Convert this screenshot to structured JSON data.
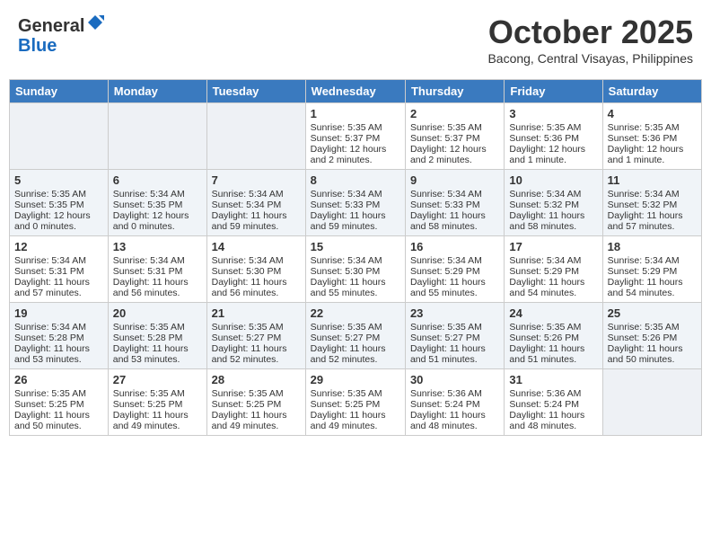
{
  "header": {
    "logo_line1": "General",
    "logo_line2": "Blue",
    "month": "October 2025",
    "location": "Bacong, Central Visayas, Philippines"
  },
  "weekdays": [
    "Sunday",
    "Monday",
    "Tuesday",
    "Wednesday",
    "Thursday",
    "Friday",
    "Saturday"
  ],
  "weeks": [
    [
      {
        "day": "",
        "empty": true
      },
      {
        "day": "",
        "empty": true
      },
      {
        "day": "",
        "empty": true
      },
      {
        "day": "1",
        "sunrise": "Sunrise: 5:35 AM",
        "sunset": "Sunset: 5:37 PM",
        "daylight": "Daylight: 12 hours and 2 minutes."
      },
      {
        "day": "2",
        "sunrise": "Sunrise: 5:35 AM",
        "sunset": "Sunset: 5:37 PM",
        "daylight": "Daylight: 12 hours and 2 minutes."
      },
      {
        "day": "3",
        "sunrise": "Sunrise: 5:35 AM",
        "sunset": "Sunset: 5:36 PM",
        "daylight": "Daylight: 12 hours and 1 minute."
      },
      {
        "day": "4",
        "sunrise": "Sunrise: 5:35 AM",
        "sunset": "Sunset: 5:36 PM",
        "daylight": "Daylight: 12 hours and 1 minute."
      }
    ],
    [
      {
        "day": "5",
        "sunrise": "Sunrise: 5:35 AM",
        "sunset": "Sunset: 5:35 PM",
        "daylight": "Daylight: 12 hours and 0 minutes."
      },
      {
        "day": "6",
        "sunrise": "Sunrise: 5:34 AM",
        "sunset": "Sunset: 5:35 PM",
        "daylight": "Daylight: 12 hours and 0 minutes."
      },
      {
        "day": "7",
        "sunrise": "Sunrise: 5:34 AM",
        "sunset": "Sunset: 5:34 PM",
        "daylight": "Daylight: 11 hours and 59 minutes."
      },
      {
        "day": "8",
        "sunrise": "Sunrise: 5:34 AM",
        "sunset": "Sunset: 5:33 PM",
        "daylight": "Daylight: 11 hours and 59 minutes."
      },
      {
        "day": "9",
        "sunrise": "Sunrise: 5:34 AM",
        "sunset": "Sunset: 5:33 PM",
        "daylight": "Daylight: 11 hours and 58 minutes."
      },
      {
        "day": "10",
        "sunrise": "Sunrise: 5:34 AM",
        "sunset": "Sunset: 5:32 PM",
        "daylight": "Daylight: 11 hours and 58 minutes."
      },
      {
        "day": "11",
        "sunrise": "Sunrise: 5:34 AM",
        "sunset": "Sunset: 5:32 PM",
        "daylight": "Daylight: 11 hours and 57 minutes."
      }
    ],
    [
      {
        "day": "12",
        "sunrise": "Sunrise: 5:34 AM",
        "sunset": "Sunset: 5:31 PM",
        "daylight": "Daylight: 11 hours and 57 minutes."
      },
      {
        "day": "13",
        "sunrise": "Sunrise: 5:34 AM",
        "sunset": "Sunset: 5:31 PM",
        "daylight": "Daylight: 11 hours and 56 minutes."
      },
      {
        "day": "14",
        "sunrise": "Sunrise: 5:34 AM",
        "sunset": "Sunset: 5:30 PM",
        "daylight": "Daylight: 11 hours and 56 minutes."
      },
      {
        "day": "15",
        "sunrise": "Sunrise: 5:34 AM",
        "sunset": "Sunset: 5:30 PM",
        "daylight": "Daylight: 11 hours and 55 minutes."
      },
      {
        "day": "16",
        "sunrise": "Sunrise: 5:34 AM",
        "sunset": "Sunset: 5:29 PM",
        "daylight": "Daylight: 11 hours and 55 minutes."
      },
      {
        "day": "17",
        "sunrise": "Sunrise: 5:34 AM",
        "sunset": "Sunset: 5:29 PM",
        "daylight": "Daylight: 11 hours and 54 minutes."
      },
      {
        "day": "18",
        "sunrise": "Sunrise: 5:34 AM",
        "sunset": "Sunset: 5:29 PM",
        "daylight": "Daylight: 11 hours and 54 minutes."
      }
    ],
    [
      {
        "day": "19",
        "sunrise": "Sunrise: 5:34 AM",
        "sunset": "Sunset: 5:28 PM",
        "daylight": "Daylight: 11 hours and 53 minutes."
      },
      {
        "day": "20",
        "sunrise": "Sunrise: 5:35 AM",
        "sunset": "Sunset: 5:28 PM",
        "daylight": "Daylight: 11 hours and 53 minutes."
      },
      {
        "day": "21",
        "sunrise": "Sunrise: 5:35 AM",
        "sunset": "Sunset: 5:27 PM",
        "daylight": "Daylight: 11 hours and 52 minutes."
      },
      {
        "day": "22",
        "sunrise": "Sunrise: 5:35 AM",
        "sunset": "Sunset: 5:27 PM",
        "daylight": "Daylight: 11 hours and 52 minutes."
      },
      {
        "day": "23",
        "sunrise": "Sunrise: 5:35 AM",
        "sunset": "Sunset: 5:27 PM",
        "daylight": "Daylight: 11 hours and 51 minutes."
      },
      {
        "day": "24",
        "sunrise": "Sunrise: 5:35 AM",
        "sunset": "Sunset: 5:26 PM",
        "daylight": "Daylight: 11 hours and 51 minutes."
      },
      {
        "day": "25",
        "sunrise": "Sunrise: 5:35 AM",
        "sunset": "Sunset: 5:26 PM",
        "daylight": "Daylight: 11 hours and 50 minutes."
      }
    ],
    [
      {
        "day": "26",
        "sunrise": "Sunrise: 5:35 AM",
        "sunset": "Sunset: 5:25 PM",
        "daylight": "Daylight: 11 hours and 50 minutes."
      },
      {
        "day": "27",
        "sunrise": "Sunrise: 5:35 AM",
        "sunset": "Sunset: 5:25 PM",
        "daylight": "Daylight: 11 hours and 49 minutes."
      },
      {
        "day": "28",
        "sunrise": "Sunrise: 5:35 AM",
        "sunset": "Sunset: 5:25 PM",
        "daylight": "Daylight: 11 hours and 49 minutes."
      },
      {
        "day": "29",
        "sunrise": "Sunrise: 5:35 AM",
        "sunset": "Sunset: 5:25 PM",
        "daylight": "Daylight: 11 hours and 49 minutes."
      },
      {
        "day": "30",
        "sunrise": "Sunrise: 5:36 AM",
        "sunset": "Sunset: 5:24 PM",
        "daylight": "Daylight: 11 hours and 48 minutes."
      },
      {
        "day": "31",
        "sunrise": "Sunrise: 5:36 AM",
        "sunset": "Sunset: 5:24 PM",
        "daylight": "Daylight: 11 hours and 48 minutes."
      },
      {
        "day": "",
        "empty": true
      }
    ]
  ]
}
